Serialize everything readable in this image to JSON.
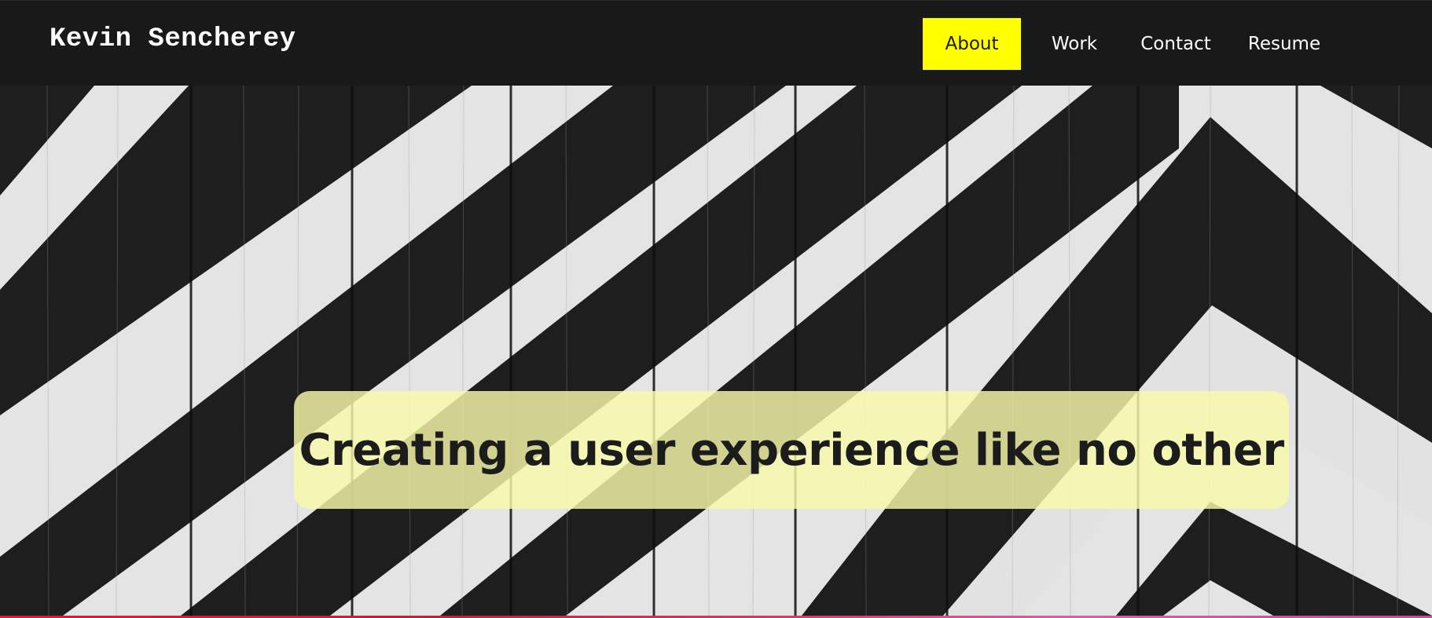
{
  "brand": {
    "name": "Kevin Sencherey"
  },
  "nav": {
    "items": [
      {
        "label": "About",
        "active": true
      },
      {
        "label": "Work",
        "active": false
      },
      {
        "label": "Contact",
        "active": false
      },
      {
        "label": "Resume",
        "active": false
      }
    ]
  },
  "hero": {
    "tagline": "Creating a user experience like no other",
    "image": "black-and-white-chevron-striped-wood-planks"
  },
  "colors": {
    "nav_background": "#191919",
    "accent": "#ffff00",
    "tagline_box": "#fafaaa",
    "text_dark": "#1c1c1c",
    "text_light": "#ffffff"
  }
}
